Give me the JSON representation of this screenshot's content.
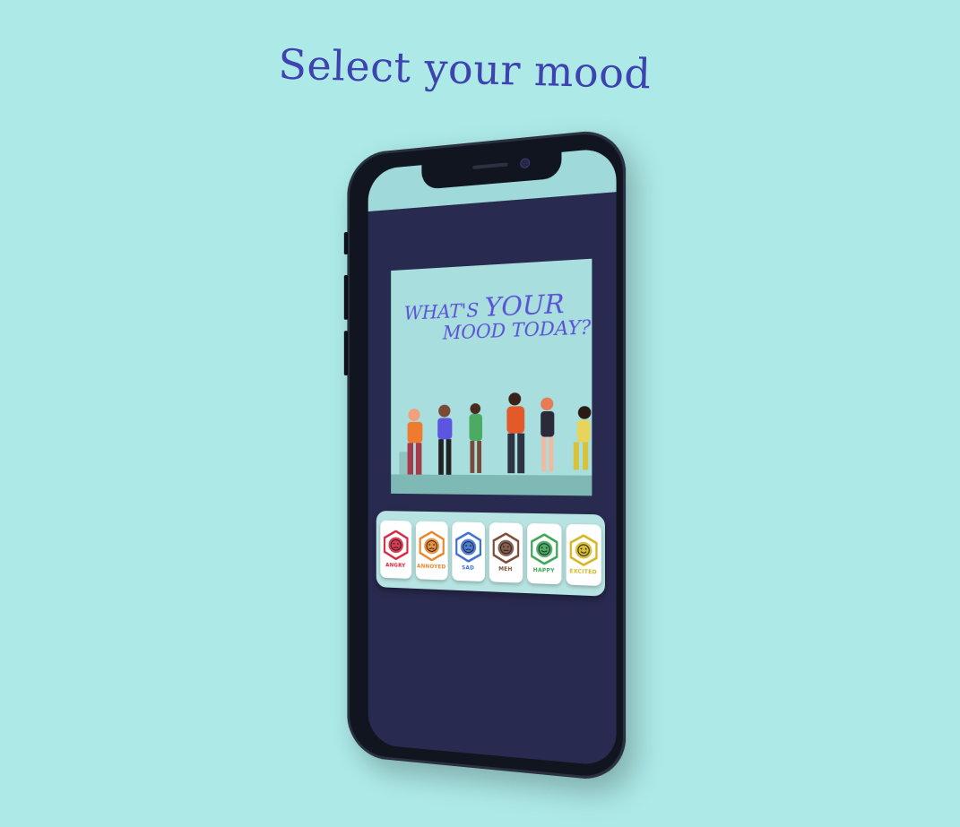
{
  "page": {
    "title": "Select your mood"
  },
  "hero": {
    "line1_a": "WHAT'S ",
    "line1_b": "YOUR",
    "line2": "MOOD TODAY?"
  },
  "moods": [
    {
      "label": "ANGRY",
      "color": "#d7263d",
      "face": "angry-face-icon"
    },
    {
      "label": "ANNOYED",
      "color": "#e8862a",
      "face": "annoyed-face-icon"
    },
    {
      "label": "SAD",
      "color": "#3b6fd4",
      "face": "sad-face-icon"
    },
    {
      "label": "MEH",
      "color": "#7a4b38",
      "face": "neutral-face-icon"
    },
    {
      "label": "HAPPY",
      "color": "#3aa655",
      "face": "happy-face-icon"
    },
    {
      "label": "EXCITED",
      "color": "#d4b71f",
      "face": "excited-face-icon"
    }
  ],
  "colors": {
    "background": "#ace9e7",
    "title": "#3e43b0",
    "screen": "#292a4f",
    "hero_bg": "#a8dedd",
    "hero_text": "#5a52d6"
  }
}
